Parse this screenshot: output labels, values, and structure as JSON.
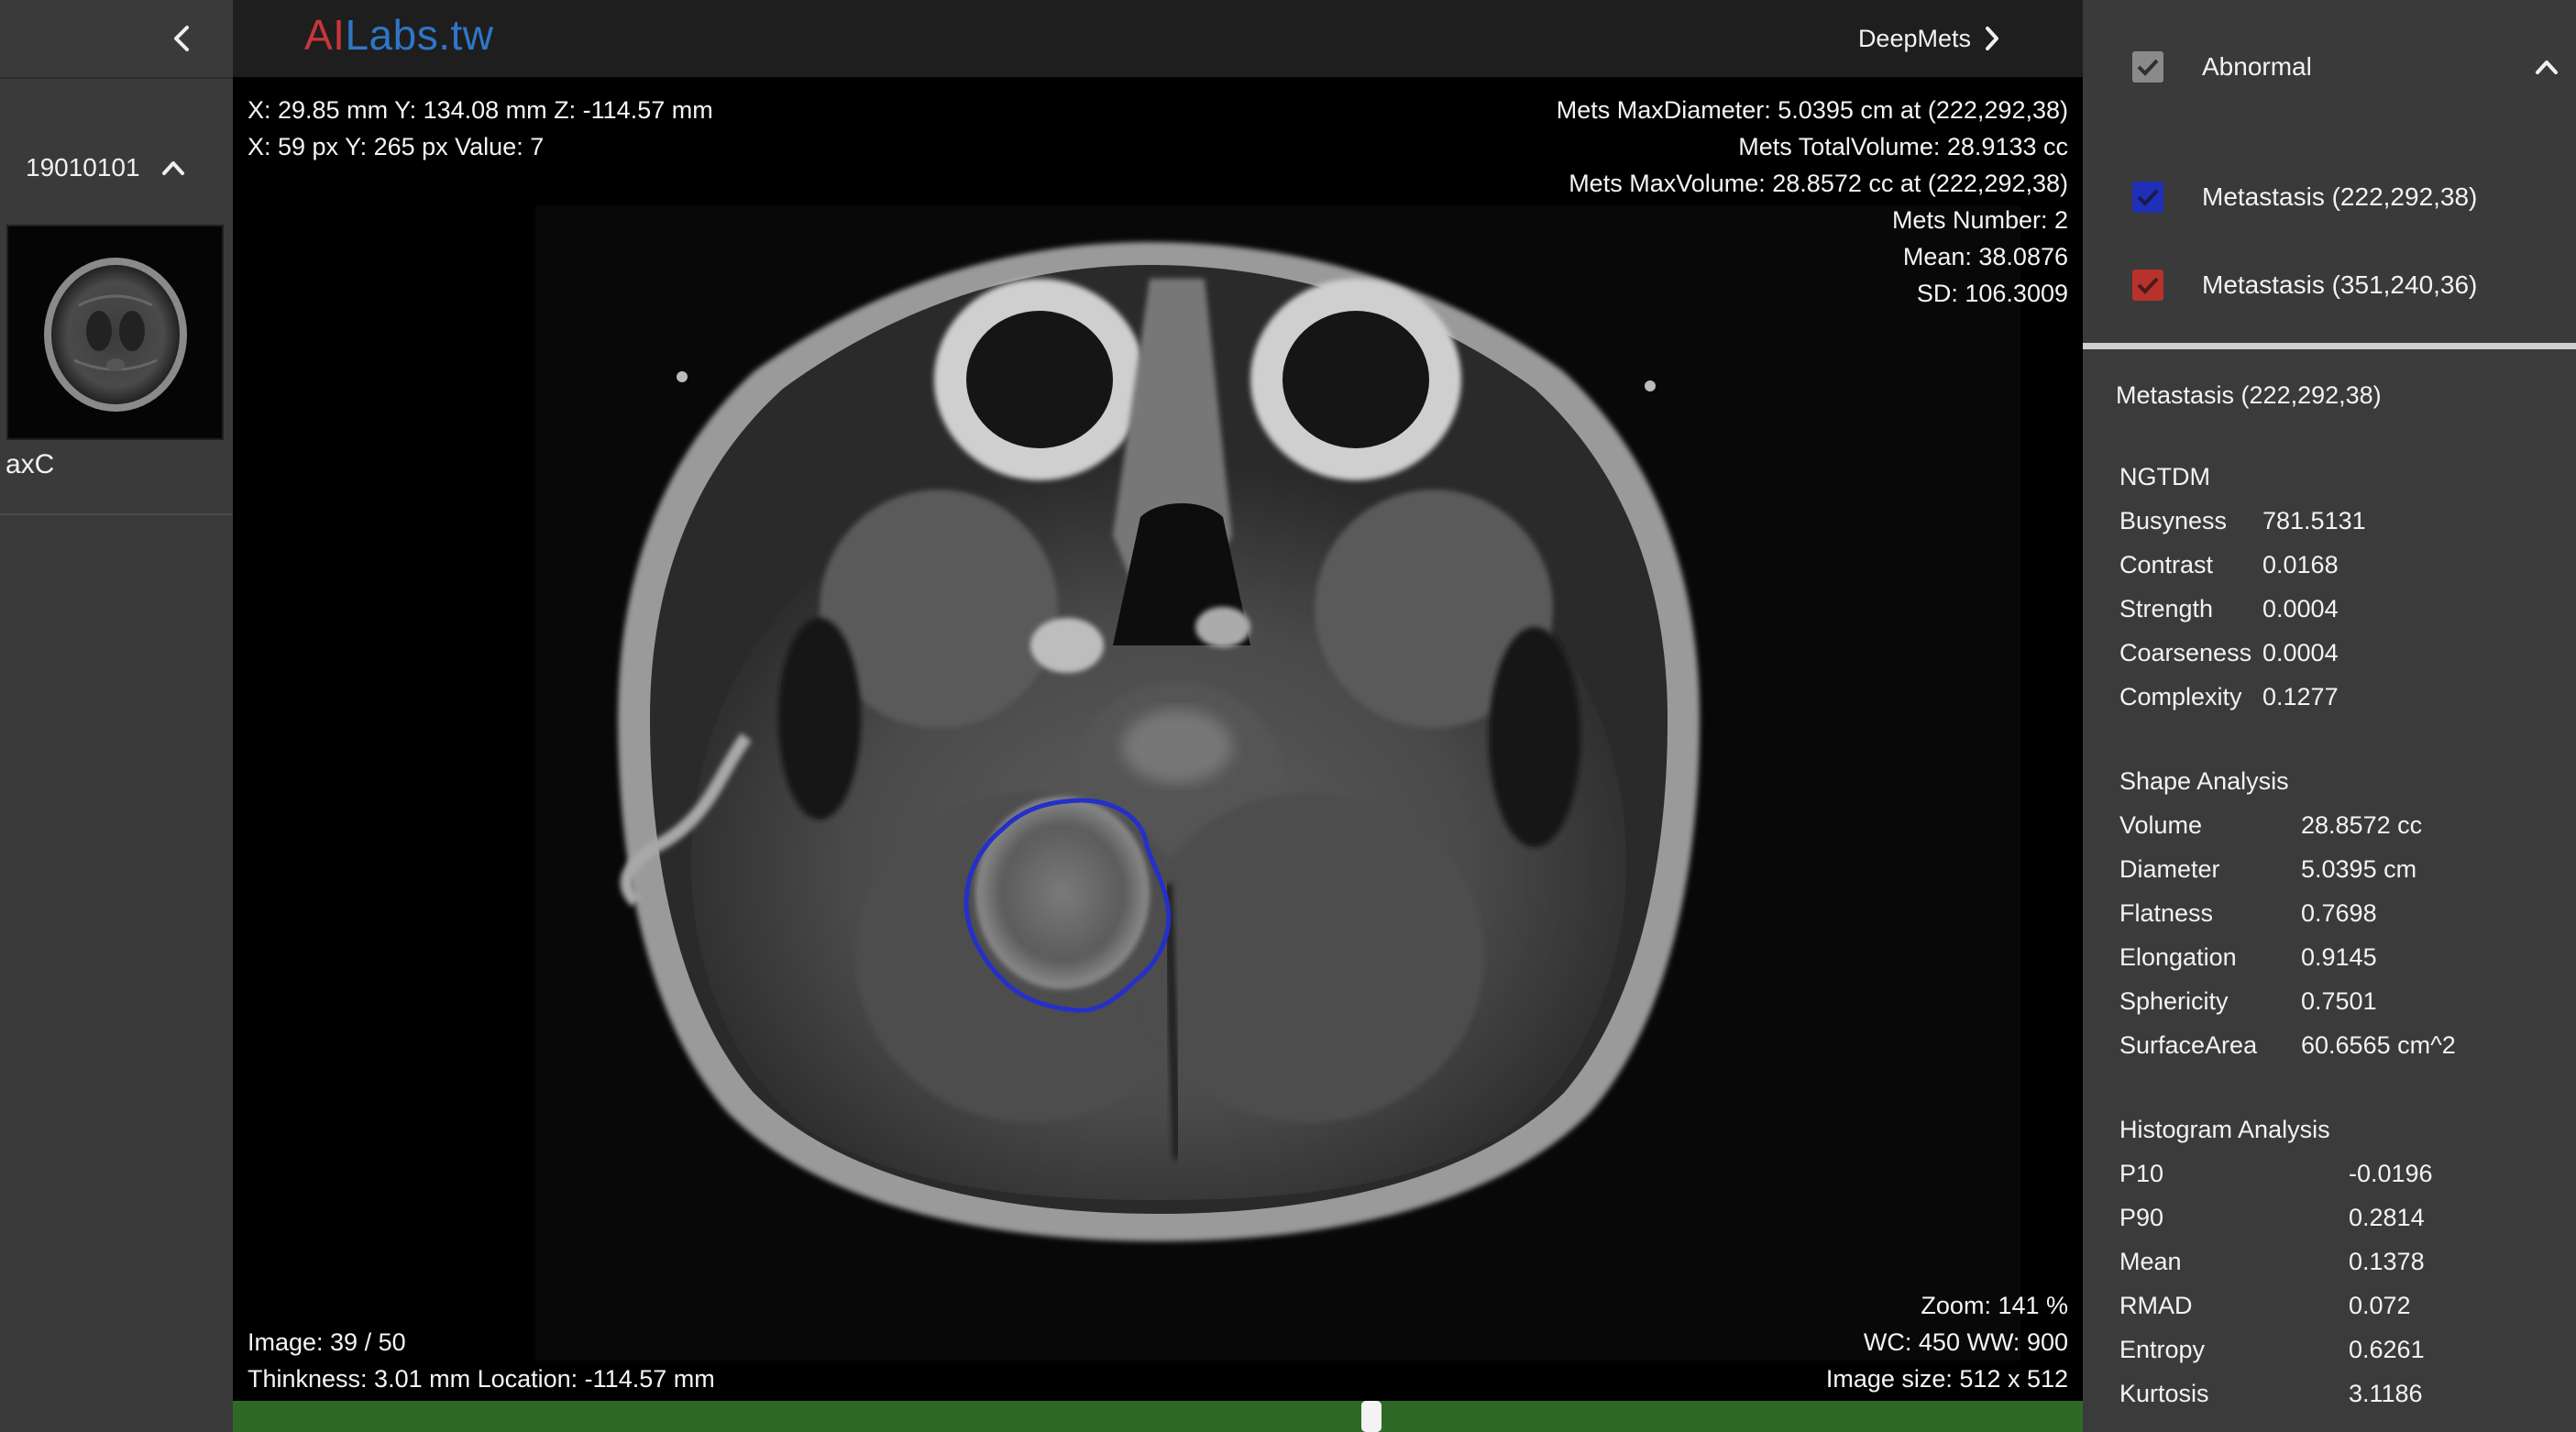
{
  "left_panel": {
    "study_id": "19010101",
    "series_label": "axC"
  },
  "topbar": {
    "logo_part1": "AI",
    "logo_part2": "Labs.tw",
    "deepmets_label": "DeepMets"
  },
  "viewport": {
    "top_left": [
      "X: 29.85 mm Y: 134.08 mm Z: -114.57 mm",
      "X: 59 px Y: 265 px Value: 7"
    ],
    "top_right": [
      "Mets MaxDiameter: 5.0395 cm at (222,292,38)",
      "Mets TotalVolume: 28.9133 cc",
      "Mets MaxVolume: 28.8572 cc at (222,292,38)",
      "Mets Number: 2",
      "Mean: 38.0876",
      "SD: 106.3009"
    ],
    "bottom_left": [
      "Image: 39 / 50",
      "Thinkness: 3.01 mm Location: -114.57 mm"
    ],
    "bottom_right": [
      "Zoom: 141 %",
      "WC: 450 WW: 900",
      "Image size: 512 x 512"
    ],
    "contour_color": "#2430c8"
  },
  "slider": {
    "current": 39,
    "total": 50,
    "color": "#2d6a26"
  },
  "findings": {
    "abnormal_label": "Abnormal",
    "items": [
      {
        "label": "Metastasis (222,292,38)",
        "color": "#1f2fb8",
        "checked": true
      },
      {
        "label": "Metastasis (351,240,36)",
        "color": "#b8322c",
        "checked": true
      }
    ]
  },
  "detail": {
    "title": "Metastasis (222,292,38)",
    "ngtdm": {
      "title": "NGTDM",
      "rows": [
        {
          "k": "Busyness",
          "v": "781.5131"
        },
        {
          "k": "Contrast",
          "v": "0.0168"
        },
        {
          "k": "Strength",
          "v": "0.0004"
        },
        {
          "k": "Coarseness",
          "v": "0.0004"
        },
        {
          "k": "Complexity",
          "v": "0.1277"
        }
      ]
    },
    "shape": {
      "title": "Shape Analysis",
      "rows": [
        {
          "k": "Volume",
          "v": "28.8572 cc"
        },
        {
          "k": "Diameter",
          "v": "5.0395 cm"
        },
        {
          "k": "Flatness",
          "v": "0.7698"
        },
        {
          "k": "Elongation",
          "v": "0.9145"
        },
        {
          "k": "Sphericity",
          "v": "0.7501"
        },
        {
          "k": "SurfaceArea",
          "v": "60.6565 cm^2"
        }
      ]
    },
    "histogram": {
      "title": "Histogram Analysis",
      "rows": [
        {
          "k": "P10",
          "v": "-0.0196"
        },
        {
          "k": "P90",
          "v": "0.2814"
        },
        {
          "k": "Mean",
          "v": "0.1378"
        },
        {
          "k": "RMAD",
          "v": "0.072"
        },
        {
          "k": "Entropy",
          "v": "0.6261"
        },
        {
          "k": "Kurtosis",
          "v": "3.1186"
        }
      ]
    }
  }
}
